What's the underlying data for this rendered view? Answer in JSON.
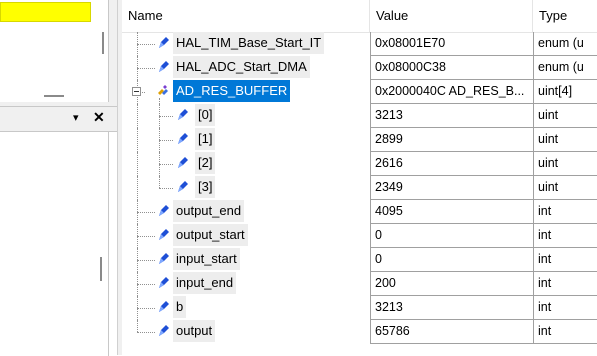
{
  "columns": {
    "name": "Name",
    "value": "Value",
    "type": "Type"
  },
  "panel": {
    "dropdown_glyph": "▾",
    "close_glyph": "✕"
  },
  "rows": [
    {
      "name": "HAL_TIM_Base_Start_IT",
      "value": "0x08001E70",
      "type": "enum (u",
      "icon": "variable-icon"
    },
    {
      "name": "HAL_ADC_Start_DMA",
      "value": "0x08000C38",
      "type": "enum (u",
      "icon": "variable-icon"
    },
    {
      "name": "AD_RES_BUFFER",
      "value": "0x2000040C AD_RES_B...",
      "type": "uint[4]",
      "icon": "array-icon",
      "expanded": true,
      "selected": true
    },
    {
      "name": "[0]",
      "value": "3213",
      "type": "uint",
      "icon": "variable-icon",
      "child": true
    },
    {
      "name": "[1]",
      "value": "2899",
      "type": "uint",
      "icon": "variable-icon",
      "child": true
    },
    {
      "name": "[2]",
      "value": "2616",
      "type": "uint",
      "icon": "variable-icon",
      "child": true
    },
    {
      "name": "[3]",
      "value": "2349",
      "type": "uint",
      "icon": "variable-icon",
      "child": true
    },
    {
      "name": "output_end",
      "value": "4095",
      "type": "int",
      "icon": "variable-icon"
    },
    {
      "name": "output_start",
      "value": "0",
      "type": "int",
      "icon": "variable-icon"
    },
    {
      "name": "input_start",
      "value": "0",
      "type": "int",
      "icon": "variable-icon"
    },
    {
      "name": "input_end",
      "value": "200",
      "type": "int",
      "icon": "variable-icon"
    },
    {
      "name": "b",
      "value": "3213",
      "type": "int",
      "icon": "variable-icon"
    },
    {
      "name": "output",
      "value": "65786",
      "type": "int",
      "icon": "variable-icon"
    }
  ],
  "colors": {
    "selection": "#0078d7",
    "highlight": "#ffff00",
    "icon": "#1e4fd6"
  }
}
